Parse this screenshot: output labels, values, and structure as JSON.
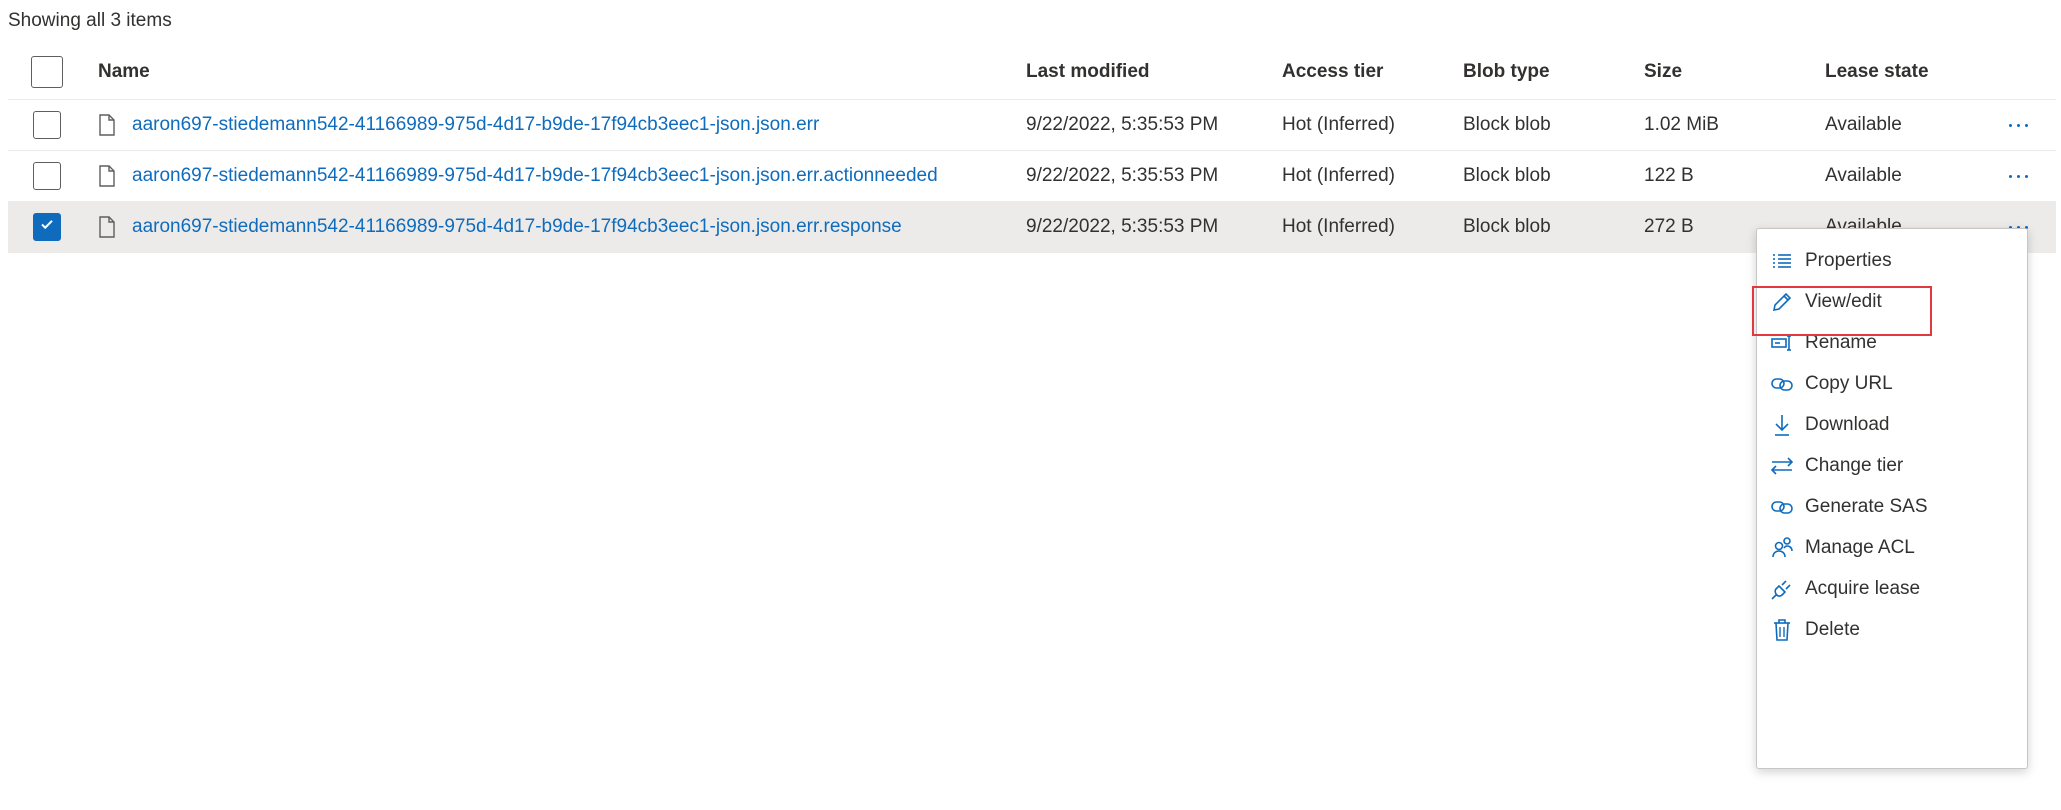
{
  "summary": "Showing all 3 items",
  "columns": {
    "name": "Name",
    "modified": "Last modified",
    "tier": "Access tier",
    "type": "Blob type",
    "size": "Size",
    "lease": "Lease state"
  },
  "rows": [
    {
      "name": "aaron697-stiedemann542-41166989-975d-4d17-b9de-17f94cb3eec1-json.json.err",
      "modified": "9/22/2022, 5:35:53 PM",
      "tier": "Hot (Inferred)",
      "type": "Block blob",
      "size": "1.02 MiB",
      "lease": "Available",
      "selected": false
    },
    {
      "name": "aaron697-stiedemann542-41166989-975d-4d17-b9de-17f94cb3eec1-json.json.err.actionneeded",
      "modified": "9/22/2022, 5:35:53 PM",
      "tier": "Hot (Inferred)",
      "type": "Block blob",
      "size": "122 B",
      "lease": "Available",
      "selected": false
    },
    {
      "name": "aaron697-stiedemann542-41166989-975d-4d17-b9de-17f94cb3eec1-json.json.err.response",
      "modified": "9/22/2022, 5:35:53 PM",
      "tier": "Hot (Inferred)",
      "type": "Block blob",
      "size": "272 B",
      "lease": "Available",
      "selected": true
    }
  ],
  "context_menu": {
    "items": [
      {
        "label": "Properties",
        "icon": "properties-icon"
      },
      {
        "label": "View/edit",
        "icon": "pencil-icon",
        "highlighted": true
      },
      {
        "label": "Rename",
        "icon": "rename-icon"
      },
      {
        "label": "Copy URL",
        "icon": "link-icon"
      },
      {
        "label": "Download",
        "icon": "download-icon"
      },
      {
        "label": "Change tier",
        "icon": "swap-arrows-icon"
      },
      {
        "label": "Generate SAS",
        "icon": "link-icon"
      },
      {
        "label": "Manage ACL",
        "icon": "users-icon"
      },
      {
        "label": "Acquire lease",
        "icon": "plug-icon"
      },
      {
        "label": "Delete",
        "icon": "trash-icon"
      }
    ]
  },
  "colors": {
    "accent": "#0f6cbd",
    "selected_row": "#edebe9",
    "highlight_box": "#e0393e"
  }
}
